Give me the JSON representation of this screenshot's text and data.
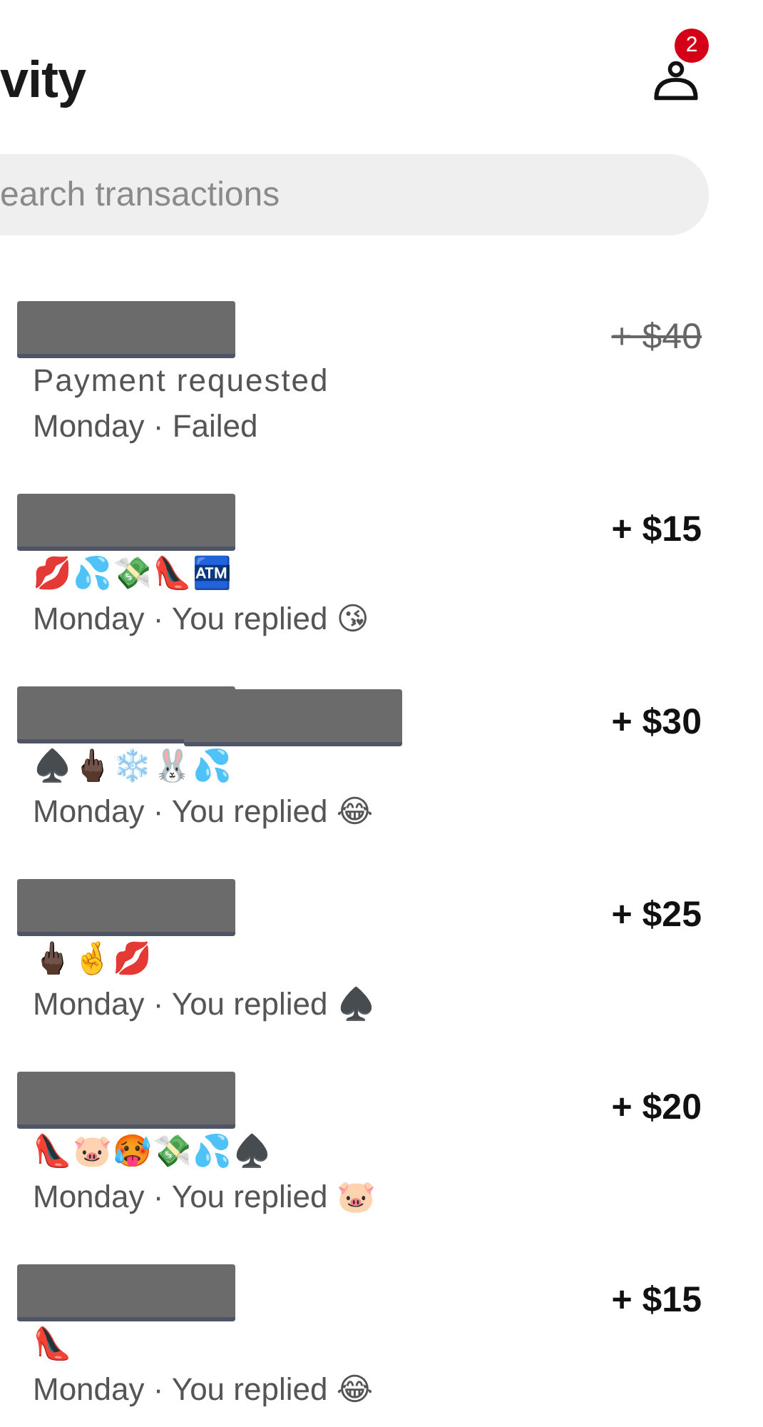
{
  "header": {
    "title": "vity",
    "notifications": {
      "badge": "2"
    }
  },
  "search": {
    "placeholder": "earch transactions"
  },
  "transactions": [
    {
      "redactions": [
        {
          "kind": "block"
        }
      ],
      "amount": "+ $40",
      "struck": true,
      "note": "Payment requested",
      "meta": "Monday · Failed"
    },
    {
      "redactions": [
        {
          "kind": "block"
        }
      ],
      "amount": "+ $15",
      "struck": false,
      "note": "💋💦💸👠🏧",
      "meta": "Monday · You replied 😘"
    },
    {
      "redactions": [
        {
          "kind": "block"
        },
        {
          "kind": "block"
        }
      ],
      "amount": "+ $30",
      "struck": false,
      "note": "♠️🖕🏿❄️🐰💦",
      "meta": "Monday · You replied 😂"
    },
    {
      "redactions": [
        {
          "kind": "block"
        }
      ],
      "amount": "+ $25",
      "struck": false,
      "note": "🖕🏿🤞💋",
      "meta": "Monday · You replied ♠️"
    },
    {
      "redactions": [
        {
          "kind": "block"
        }
      ],
      "amount": "+ $20",
      "struck": false,
      "note": "👠🐷🥵💸💦♠️",
      "meta": "Monday · You replied 🐷"
    },
    {
      "redactions": [
        {
          "kind": "block"
        }
      ],
      "amount": "+ $15",
      "struck": false,
      "note": "👠",
      "meta": "Monday · You replied 😂"
    }
  ]
}
